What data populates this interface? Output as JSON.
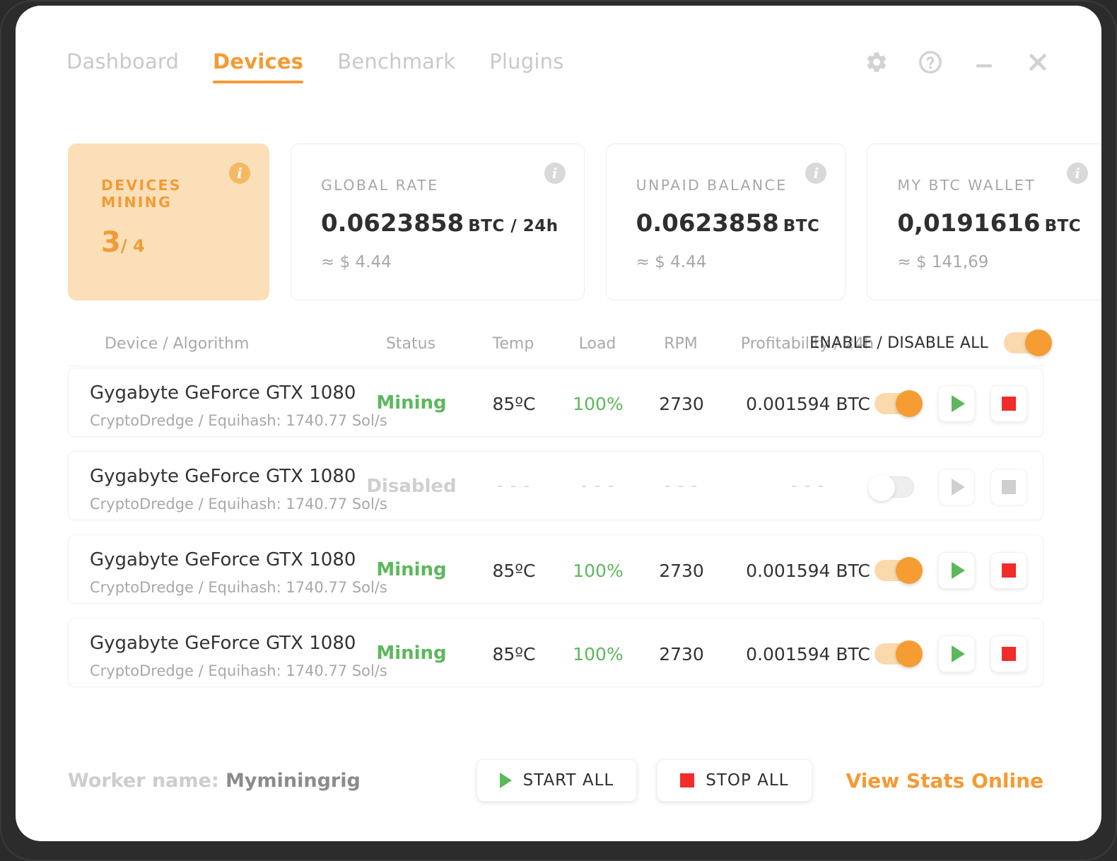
{
  "window": {
    "nav": [
      {
        "label": "Dashboard",
        "active": false
      },
      {
        "label": "Devices",
        "active": true
      },
      {
        "label": "Benchmark",
        "active": false
      },
      {
        "label": "Plugins",
        "active": false
      }
    ],
    "controls": [
      {
        "name": "settings-icon",
        "label": "Settings"
      },
      {
        "name": "help-icon",
        "label": "Help"
      },
      {
        "name": "minimize-icon",
        "label": "Minimize"
      },
      {
        "name": "close-icon",
        "label": "Close"
      }
    ]
  },
  "cards": {
    "devices_mining": {
      "label": "DEVICES MINING",
      "active": "3",
      "total": "/ 4",
      "info": "i"
    },
    "global_rate": {
      "label": "GLOBAL RATE",
      "value": "0.0623858",
      "unit": "BTC / 24h",
      "sub": "≈ $ 4.44",
      "info": "i"
    },
    "unpaid_balance": {
      "label": "UNPAID BALANCE",
      "value": "0.0623858",
      "unit": "BTC",
      "sub": "≈ $ 4.44",
      "info": "i"
    },
    "btc_wallet": {
      "label": "MY BTC WALLET",
      "value": "0,0191616",
      "unit": "BTC",
      "sub": "≈ $ 141,69",
      "info": "i"
    }
  },
  "table": {
    "headers": {
      "device": "Device / Algorithm",
      "status": "Status",
      "temp": "Temp",
      "load": "Load",
      "rpm": "RPM",
      "profitability": "Profitability / 24h",
      "enable_all": "ENABLE / DISABLE ALL"
    },
    "enable_all_on": true,
    "rows": [
      {
        "device": "Gygabyte GeForce GTX 1080",
        "algorithm": "CryptoDredge / Equihash: 1740.77 Sol/s",
        "status": "Mining",
        "temp": "85ºC",
        "load": "100%",
        "rpm": "2730",
        "profitability": "0.001594 BTC",
        "enabled": true
      },
      {
        "device": "Gygabyte GeForce GTX 1080",
        "algorithm": "CryptoDredge / Equihash: 1740.77 Sol/s",
        "status": "Disabled",
        "temp": "- - -",
        "load": "- - -",
        "rpm": "- - -",
        "profitability": "- - -",
        "enabled": false
      },
      {
        "device": "Gygabyte GeForce GTX 1080",
        "algorithm": "CryptoDredge / Equihash: 1740.77 Sol/s",
        "status": "Mining",
        "temp": "85ºC",
        "load": "100%",
        "rpm": "2730",
        "profitability": "0.001594 BTC",
        "enabled": true
      },
      {
        "device": "Gygabyte GeForce GTX 1080",
        "algorithm": "CryptoDredge / Equihash: 1740.77 Sol/s",
        "status": "Mining",
        "temp": "85ºC",
        "load": "100%",
        "rpm": "2730",
        "profitability": "0.001594 BTC",
        "enabled": true
      }
    ]
  },
  "footer": {
    "worker_label": "Worker name:",
    "worker_name": "Myminingrig",
    "start_all": "START ALL",
    "stop_all": "STOP ALL",
    "stats_link": "View Stats Online"
  },
  "colors": {
    "accent": "#f59a33",
    "accent_light": "#fbdfb8",
    "mining_green": "#5cb85c",
    "stop_red": "#f22b2b",
    "muted": "#a8a8a8",
    "disabled": "#cfcfcf"
  }
}
